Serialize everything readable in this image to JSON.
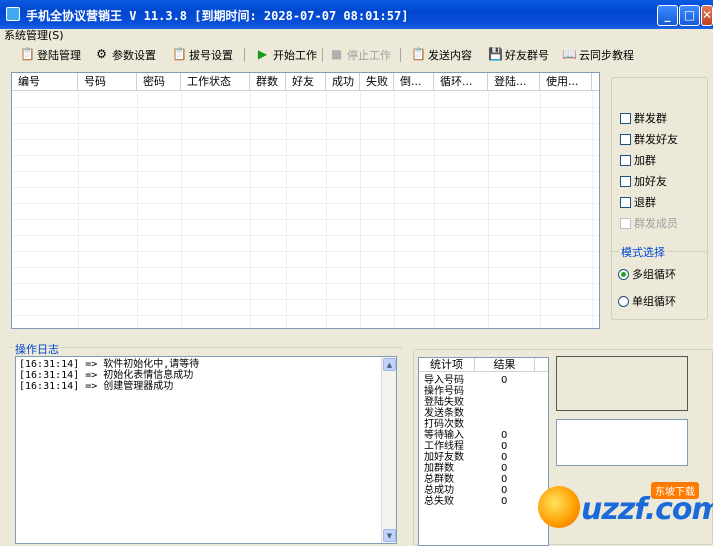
{
  "window": {
    "title": "手机全协议营销王 V 11.3.8 [到期时间: 2028-07-07 08:01:57]"
  },
  "menu": {
    "system": "系统管理(S)"
  },
  "toolbar": {
    "login_manage": "登陆管理",
    "param_settings": "参数设置",
    "dial_settings": "拔号设置",
    "start_work": "开始工作",
    "stop_work": "停止工作",
    "send_content": "发送内容",
    "friend_group_number": "好友群号",
    "cloud_sync_tutorial": "云同步教程"
  },
  "grid": {
    "columns": [
      "编号",
      "号码",
      "密码",
      "工作状态",
      "群数",
      "好友",
      "成功",
      "失败",
      "倒...",
      "循环...",
      "登陆...",
      "使用..."
    ]
  },
  "options": {
    "send_group": "群发群",
    "send_friends": "群发好友",
    "add_group": "加群",
    "add_friend": "加好友",
    "quit_group": "退群",
    "send_members": "群发成员"
  },
  "mode": {
    "label": "模式选择",
    "multi_loop": "多组循环",
    "single_loop": "单组循环",
    "selected": "multi_loop"
  },
  "log": {
    "label": "操作日志",
    "lines": [
      "[16:31:14] => 软件初始化中,请等待",
      "[16:31:14] => 初始化表情信息成功",
      "[16:31:14] => 创建管理器成功"
    ]
  },
  "stats": {
    "header_item": "统计项",
    "header_result": "结果",
    "rows": [
      {
        "label": "导入号码",
        "value": "0"
      },
      {
        "label": "操作号码",
        "value": ""
      },
      {
        "label": "登陆失败",
        "value": ""
      },
      {
        "label": "发送条数",
        "value": ""
      },
      {
        "label": "打码次数",
        "value": ""
      },
      {
        "label": "等待输入",
        "value": "0"
      },
      {
        "label": "工作线程",
        "value": "0"
      },
      {
        "label": "加好友数",
        "value": "0"
      },
      {
        "label": "加群数",
        "value": "0"
      },
      {
        "label": "总群数",
        "value": "0"
      },
      {
        "label": "总成功",
        "value": "0"
      },
      {
        "label": "总失败",
        "value": "0"
      }
    ]
  },
  "watermark": {
    "brand": "uzzf.com",
    "badge": "东坡下载"
  }
}
